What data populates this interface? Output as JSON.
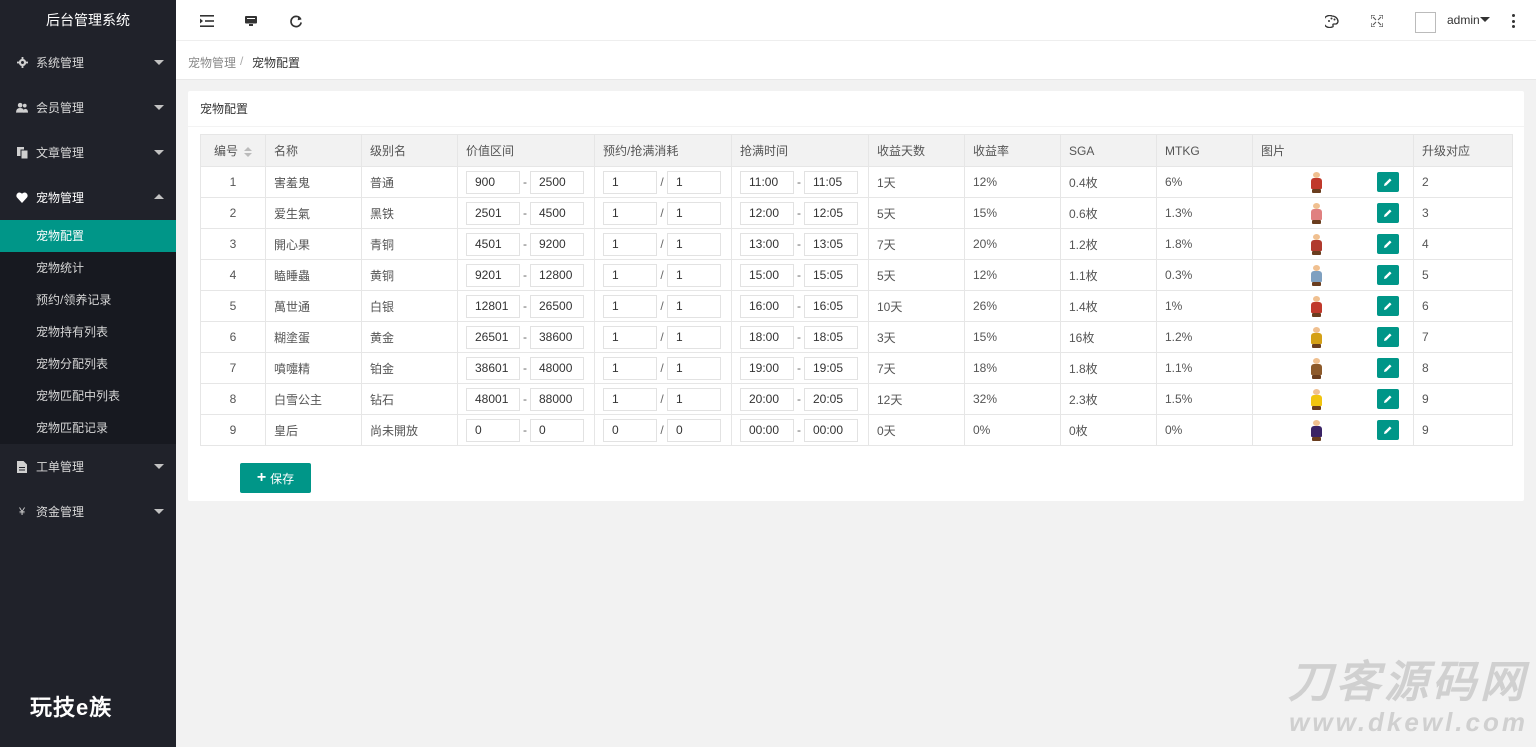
{
  "sidebar": {
    "brand": "后台管理系统",
    "menu": [
      {
        "label": "系统管理",
        "icon": "gear-icon"
      },
      {
        "label": "会员管理",
        "icon": "users-icon"
      },
      {
        "label": "文章管理",
        "icon": "copy-icon"
      },
      {
        "label": "宠物管理",
        "icon": "heart-icon"
      },
      {
        "label": "工单管理",
        "icon": "file-icon"
      },
      {
        "label": "资金管理",
        "icon": "yen-icon",
        "glyph": "¥"
      }
    ],
    "pet_sub": [
      "宠物配置",
      "宠物统计",
      "预约/领养记录",
      "宠物持有列表",
      "宠物分配列表",
      "宠物匹配中列表",
      "宠物匹配记录"
    ],
    "logo_text": "玩技e族"
  },
  "header": {
    "user": "admin"
  },
  "breadcrumb": {
    "parent": "宠物管理",
    "separator": "/",
    "current": "宠物配置"
  },
  "card": {
    "title": "宠物配置",
    "columns": [
      "编号",
      "名称",
      "级别名",
      "价值区间",
      "预约/抢满消耗",
      "抢满时间",
      "收益天数",
      "收益率",
      "SGA",
      "MTKG",
      "图片",
      "升级对应"
    ],
    "rows": [
      {
        "id": "1",
        "name": "害羞鬼",
        "level": "普通",
        "vmin": "900",
        "vmax": "2500",
        "c1": "1",
        "c2": "1",
        "t1": "11:00",
        "t2": "11:05",
        "days": "1天",
        "rate": "12%",
        "sga": "0.4枚",
        "mtkg": "6%",
        "up": "2",
        "color": "#c0392b"
      },
      {
        "id": "2",
        "name": "爱生氣",
        "level": "黑铁",
        "vmin": "2501",
        "vmax": "4500",
        "c1": "1",
        "c2": "1",
        "t1": "12:00",
        "t2": "12:05",
        "days": "5天",
        "rate": "15%",
        "sga": "0.6枚",
        "mtkg": "1.3%",
        "up": "3",
        "color": "#e08080"
      },
      {
        "id": "3",
        "name": "開心果",
        "level": "青铜",
        "vmin": "4501",
        "vmax": "9200",
        "c1": "1",
        "c2": "1",
        "t1": "13:00",
        "t2": "13:05",
        "days": "7天",
        "rate": "20%",
        "sga": "1.2枚",
        "mtkg": "1.8%",
        "up": "4",
        "color": "#b03a2e"
      },
      {
        "id": "4",
        "name": "瞌睡蟲",
        "level": "黄铜",
        "vmin": "9201",
        "vmax": "12800",
        "c1": "1",
        "c2": "1",
        "t1": "15:00",
        "t2": "15:05",
        "days": "5天",
        "rate": "12%",
        "sga": "1.1枚",
        "mtkg": "0.3%",
        "up": "5",
        "color": "#7fa0c0"
      },
      {
        "id": "5",
        "name": "萬世通",
        "level": "白银",
        "vmin": "12801",
        "vmax": "26500",
        "c1": "1",
        "c2": "1",
        "t1": "16:00",
        "t2": "16:05",
        "days": "10天",
        "rate": "26%",
        "sga": "1.4枚",
        "mtkg": "1%",
        "up": "6",
        "color": "#c0392b"
      },
      {
        "id": "6",
        "name": "糊塗蛋",
        "level": "黄金",
        "vmin": "26501",
        "vmax": "38600",
        "c1": "1",
        "c2": "1",
        "t1": "18:00",
        "t2": "18:05",
        "days": "3天",
        "rate": "15%",
        "sga": "16枚",
        "mtkg": "1.2%",
        "up": "7",
        "color": "#d4a017"
      },
      {
        "id": "7",
        "name": "噴嚏精",
        "level": "铂金",
        "vmin": "38601",
        "vmax": "48000",
        "c1": "1",
        "c2": "1",
        "t1": "19:00",
        "t2": "19:05",
        "days": "7天",
        "rate": "18%",
        "sga": "1.8枚",
        "mtkg": "1.1%",
        "up": "8",
        "color": "#8d5a2b"
      },
      {
        "id": "8",
        "name": "白雪公主",
        "level": "钻石",
        "vmin": "48001",
        "vmax": "88000",
        "c1": "1",
        "c2": "1",
        "t1": "20:00",
        "t2": "20:05",
        "days": "12天",
        "rate": "32%",
        "sga": "2.3枚",
        "mtkg": "1.5%",
        "up": "9",
        "color": "#f1c40f"
      },
      {
        "id": "9",
        "name": "皇后",
        "level": "尚未開放",
        "vmin": "0",
        "vmax": "0",
        "c1": "0",
        "c2": "0",
        "t1": "00:00",
        "t2": "00:00",
        "days": "0天",
        "rate": "0%",
        "sga": "0枚",
        "mtkg": "0%",
        "up": "9",
        "color": "#3b2466"
      }
    ],
    "save_label": "保存"
  },
  "watermark": {
    "line1": "刀客源码网",
    "line2": "www.dkewl.com"
  }
}
